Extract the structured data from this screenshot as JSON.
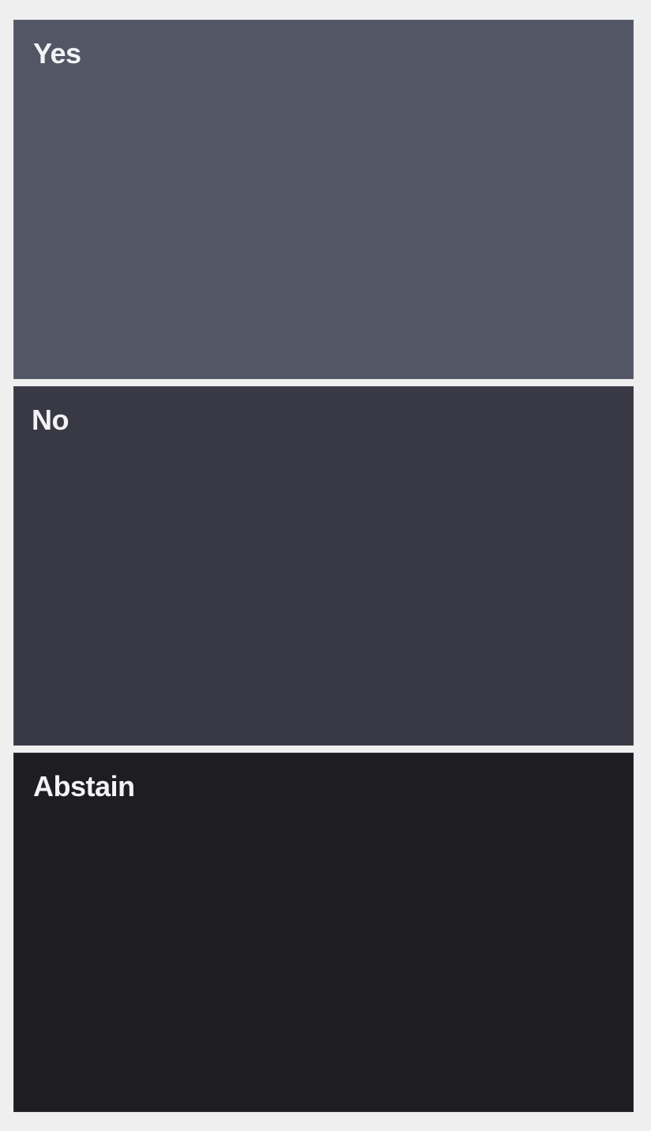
{
  "vote": {
    "options": [
      {
        "label": "Yes",
        "color": "#535665"
      },
      {
        "label": "No",
        "color": "#383944"
      },
      {
        "label": "Abstain",
        "color": "#1e1d22"
      }
    ]
  },
  "page": {
    "background": "#efefef"
  }
}
